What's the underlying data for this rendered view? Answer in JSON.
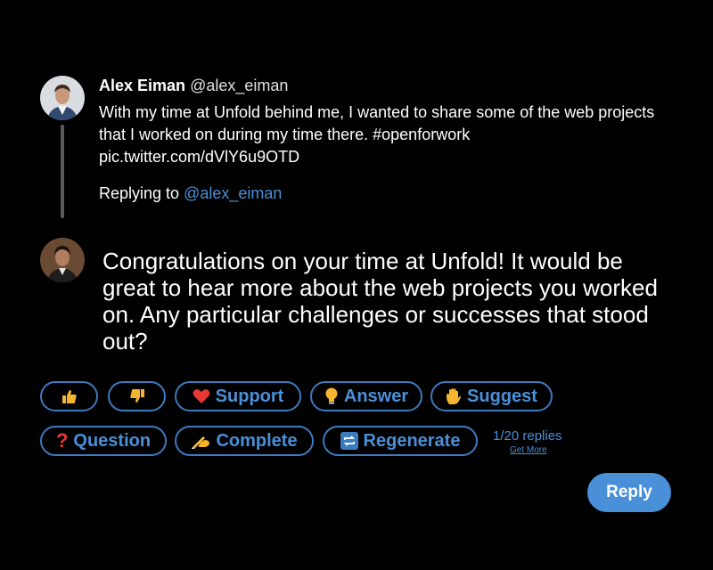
{
  "original_tweet": {
    "author_name": "Alex Eiman",
    "author_handle": "@alex_eiman",
    "text": "With my time at Unfold behind me, I wanted to share some of the web projects that I worked on during my time there. #openforwork pic.twitter.com/dVlY6u9OTD",
    "replying_label": "Replying to",
    "replying_handle": "@alex_eiman"
  },
  "suggested_reply": {
    "text": "Congratulations on your time at Unfold! It would be great to hear more about the web projects you worked on. Any particular challenges or successes that stood out?"
  },
  "actions": {
    "thumbs_up_icon": "thumbs-up-icon",
    "thumbs_down_icon": "thumbs-down-icon",
    "support": {
      "label": "Support",
      "icon": "heart-icon",
      "color": "#e53935"
    },
    "answer": {
      "label": "Answer",
      "icon": "lightbulb-icon",
      "color": "#f5b52e"
    },
    "suggest": {
      "label": "Suggest",
      "icon": "raised-hand-icon",
      "color": "#f5b52e"
    },
    "question": {
      "label": "Question",
      "icon": "question-mark-icon",
      "color": "#e53935"
    },
    "complete": {
      "label": "Complete",
      "icon": "writing-hand-icon",
      "color": "#f5b52e"
    },
    "regenerate": {
      "label": "Regenerate",
      "icon": "repeat-icon",
      "color": "#3d7bbf"
    }
  },
  "pagination": {
    "current": "1/20",
    "label": "replies",
    "get_more": "Get More"
  },
  "reply_button": {
    "label": "Reply"
  },
  "colors": {
    "accent": "#4a90d9",
    "background": "#000000",
    "thread_line": "#5a5a5a"
  }
}
